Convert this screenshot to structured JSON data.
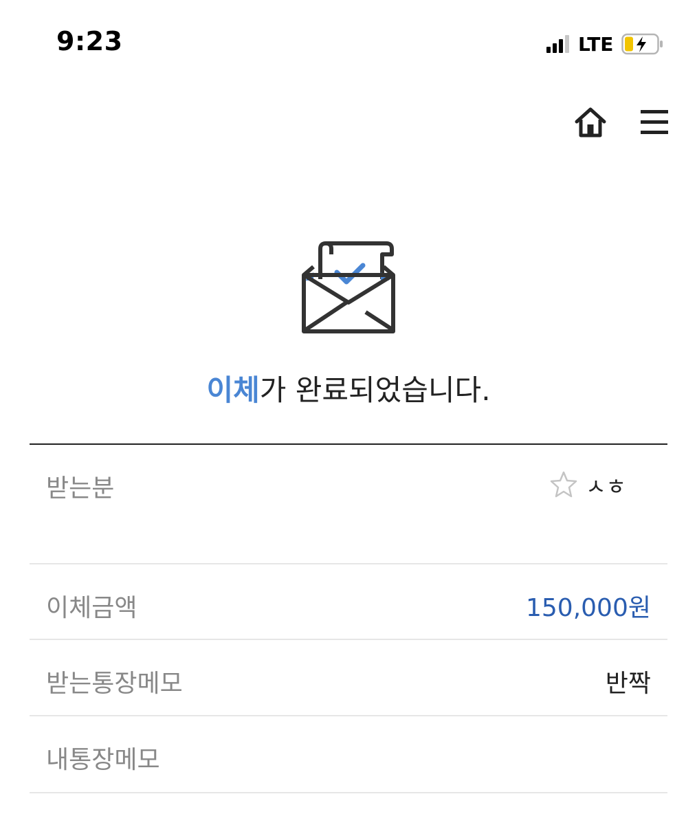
{
  "status_bar": {
    "time": "9:23",
    "network": "LTE"
  },
  "nav": {
    "home_icon": "home-icon",
    "menu_icon": "hamburger-menu-icon"
  },
  "hero": {
    "icon": "envelope-check-icon",
    "title_accent": "이체",
    "title_rest": "가 완료되었습니다.",
    "accent_color": "#4a86d4"
  },
  "details": {
    "recipient": {
      "label": "받는분",
      "name": "ㅅㅎ",
      "favorite_icon": "star-outline-icon"
    },
    "amount": {
      "label": "이체금액",
      "value": "150,000원"
    },
    "recipient_memo": {
      "label": "받는통장메모",
      "value": "반짝"
    },
    "my_memo": {
      "label": "내통장메모",
      "value": ""
    }
  }
}
